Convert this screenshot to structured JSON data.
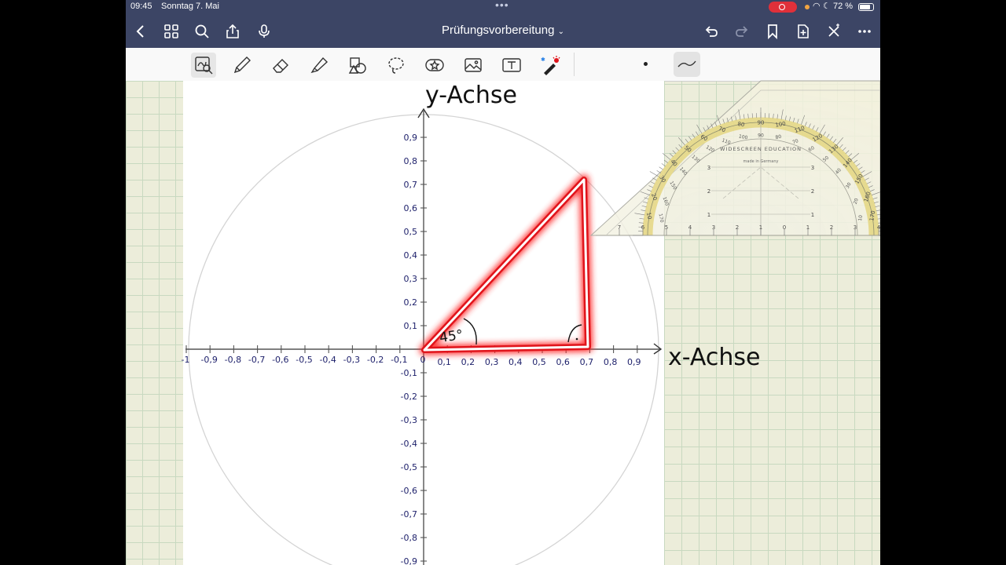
{
  "status": {
    "time": "09:45",
    "date": "Sonntag 7. Mai",
    "battery": "72 %"
  },
  "nav": {
    "title": "Prüfungsvorbereitung"
  },
  "icons": {
    "back": "chevron-left-icon",
    "grid": "grid-icon",
    "search": "search-icon",
    "share": "share-icon",
    "mic": "microphone-icon",
    "undo": "undo-icon",
    "redo": "redo-icon",
    "bookmark": "bookmark-icon",
    "add_page": "add-page-icon",
    "close": "close-icon",
    "more": "more-icon"
  },
  "tools": [
    "lasso-zoom",
    "pen",
    "eraser",
    "highlighter",
    "shapes",
    "lasso",
    "sticker",
    "image",
    "text",
    "laser-pointer"
  ],
  "colors": {
    "accent_bar": "#3c4565",
    "triangle_glow": "#e0141b",
    "axis_labels": "#1c1f6a"
  },
  "canvas": {
    "y_axis_label": "y-Achse",
    "x_axis_label": "x-Achse",
    "angle_label": "45°",
    "x_ticks_neg": [
      "-1",
      "-0,9",
      "-0,8",
      "-0,7",
      "-0,6",
      "-0,5",
      "-0,4",
      "-0,3",
      "-0,2",
      "-0,1",
      "0"
    ],
    "x_ticks_pos": [
      "0,1",
      "0,2",
      "0,3",
      "0,4",
      "0,5",
      "0,6",
      "0,7",
      "0,8",
      "0,9"
    ],
    "y_ticks_pos": [
      "0,9",
      "0,8",
      "0,7",
      "0,6",
      "0,5",
      "0,4",
      "0,3",
      "0,2",
      "0,1"
    ],
    "y_ticks_neg": [
      "-0,1",
      "-0,2",
      "-0,3",
      "-0,4",
      "-0,5",
      "-0,6",
      "-0,7",
      "-0,8",
      "-0,9"
    ]
  },
  "protractor": {
    "brand": "WIDESCREEN EDUCATION",
    "origin": "made in Germany",
    "outer_degrees": [
      "10",
      "20",
      "30",
      "40",
      "50",
      "60",
      "70",
      "80",
      "90",
      "100",
      "110",
      "120",
      "130",
      "140",
      "150",
      "160",
      "170"
    ],
    "base_scale": [
      "7",
      "6",
      "5",
      "4",
      "3",
      "2",
      "1",
      "0",
      "1",
      "2",
      "3",
      "4",
      "5",
      "6",
      "7"
    ],
    "height_scale": [
      "1",
      "2",
      "3"
    ]
  }
}
